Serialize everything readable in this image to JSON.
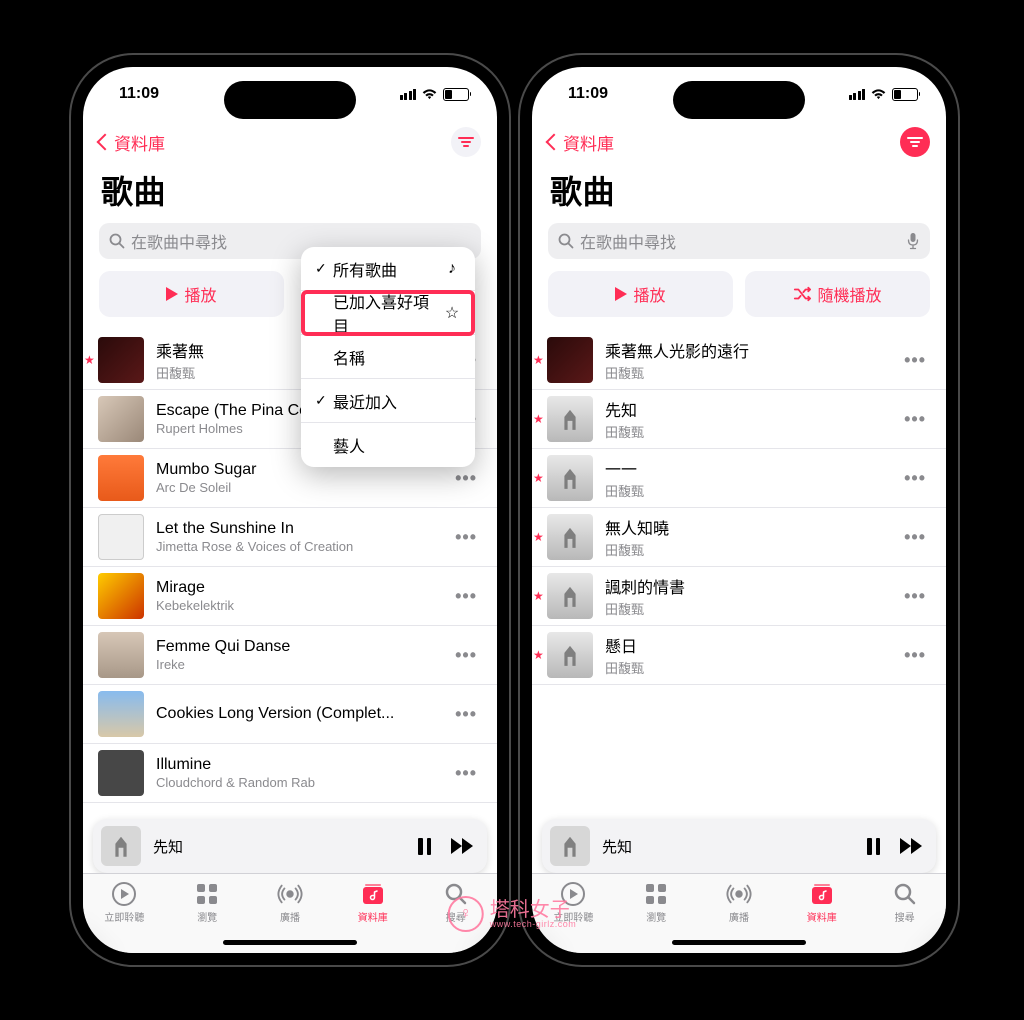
{
  "status": {
    "time": "11:09"
  },
  "nav": {
    "back": "資料庫"
  },
  "page": {
    "title": "歌曲",
    "search_placeholder": "在歌曲中尋找"
  },
  "buttons": {
    "play": "播放",
    "shuffle": "隨機播放"
  },
  "popup": {
    "items": [
      {
        "label": "所有歌曲",
        "checked": true,
        "icon": "♪"
      },
      {
        "label": "已加入喜好項目",
        "checked": false,
        "icon": "☆"
      },
      {
        "label": "名稱",
        "checked": false,
        "icon": ""
      },
      {
        "label": "最近加入",
        "checked": true,
        "icon": ""
      },
      {
        "label": "藝人",
        "checked": false,
        "icon": ""
      }
    ]
  },
  "left_songs": [
    {
      "title": "乘著無",
      "artist": "田馥甄",
      "art": "a1",
      "star": true
    },
    {
      "title": "Escape (The Pina Colada Song)",
      "artist": "Rupert Holmes",
      "art": "a2",
      "star": false
    },
    {
      "title": "Mumbo Sugar",
      "artist": "Arc De Soleil",
      "art": "a3",
      "star": false
    },
    {
      "title": "Let the Sunshine In",
      "artist": "Jimetta Rose & Voices of Creation",
      "art": "a4",
      "star": false
    },
    {
      "title": "Mirage",
      "artist": "Kebekelektrik",
      "art": "a5",
      "star": false
    },
    {
      "title": "Femme Qui Danse",
      "artist": "Ireke",
      "art": "a6",
      "star": false
    },
    {
      "title": "Cookies Long Version (Complet...",
      "artist": "",
      "art": "a7",
      "star": false
    },
    {
      "title": "Illumine",
      "artist": "Cloudchord & Random Rab",
      "art": "a8",
      "star": false
    }
  ],
  "right_songs": [
    {
      "title": "乘著無人光影的遠行",
      "artist": "田馥甄",
      "art": "a1",
      "star": true
    },
    {
      "title": "先知",
      "artist": "田馥甄",
      "art": "gray",
      "star": true
    },
    {
      "title": "一一",
      "artist": "田馥甄",
      "art": "gray",
      "star": true
    },
    {
      "title": "無人知曉",
      "artist": "田馥甄",
      "art": "gray",
      "star": true
    },
    {
      "title": "諷刺的情書",
      "artist": "田馥甄",
      "art": "gray",
      "star": true
    },
    {
      "title": "懸日",
      "artist": "田馥甄",
      "art": "gray",
      "star": true
    }
  ],
  "now_playing": {
    "title": "先知"
  },
  "tabs": [
    {
      "label": "立即聆聽",
      "icon": "play-circle"
    },
    {
      "label": "瀏覽",
      "icon": "grid"
    },
    {
      "label": "廣播",
      "icon": "radio"
    },
    {
      "label": "資料庫",
      "icon": "library",
      "active": true
    },
    {
      "label": "搜尋",
      "icon": "search"
    }
  ],
  "watermark": {
    "main": "塔科女子",
    "sub": "www.tech-girlz.com"
  }
}
